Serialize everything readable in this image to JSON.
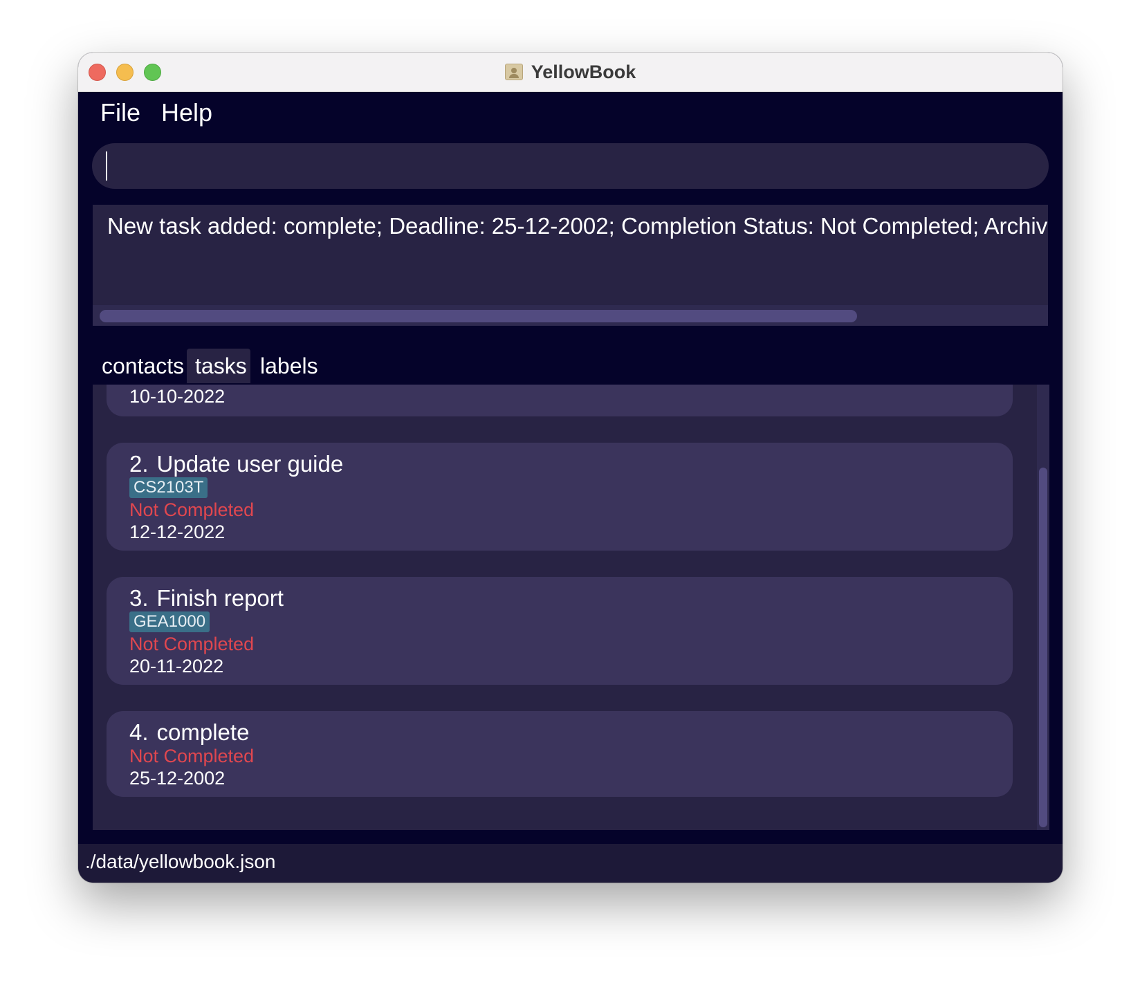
{
  "window": {
    "title": "YellowBook",
    "app_icon": "address-book-icon"
  },
  "menu": {
    "items": [
      "File",
      "Help"
    ]
  },
  "command": {
    "value": ""
  },
  "result": {
    "message": "New task added: complete; Deadline: 25-12-2002; Completion Status: Not Completed; Archival Status: Not Archived"
  },
  "tabs": [
    {
      "label": "contacts",
      "active": false
    },
    {
      "label": "tasks",
      "active": true
    },
    {
      "label": "labels",
      "active": false
    }
  ],
  "tasks": [
    {
      "index": "",
      "title": "",
      "tag": "",
      "status": "",
      "deadline": "10-10-2022"
    },
    {
      "index": "2.",
      "title": "Update user guide",
      "tag": "CS2103T",
      "status": "Not Completed",
      "deadline": "12-12-2022"
    },
    {
      "index": "3.",
      "title": "Finish report",
      "tag": "GEA1000",
      "status": "Not Completed",
      "deadline": "20-11-2022"
    },
    {
      "index": "4.",
      "title": "complete",
      "tag": "",
      "status": "Not Completed",
      "deadline": "25-12-2002"
    }
  ],
  "status_bar": {
    "file_path": "./data/yellowbook.json"
  },
  "colors": {
    "background": "#05032a",
    "panel": "#282344",
    "card": "#3b345c",
    "tag": "#3a6f88",
    "status_not_completed": "#e0474f"
  }
}
